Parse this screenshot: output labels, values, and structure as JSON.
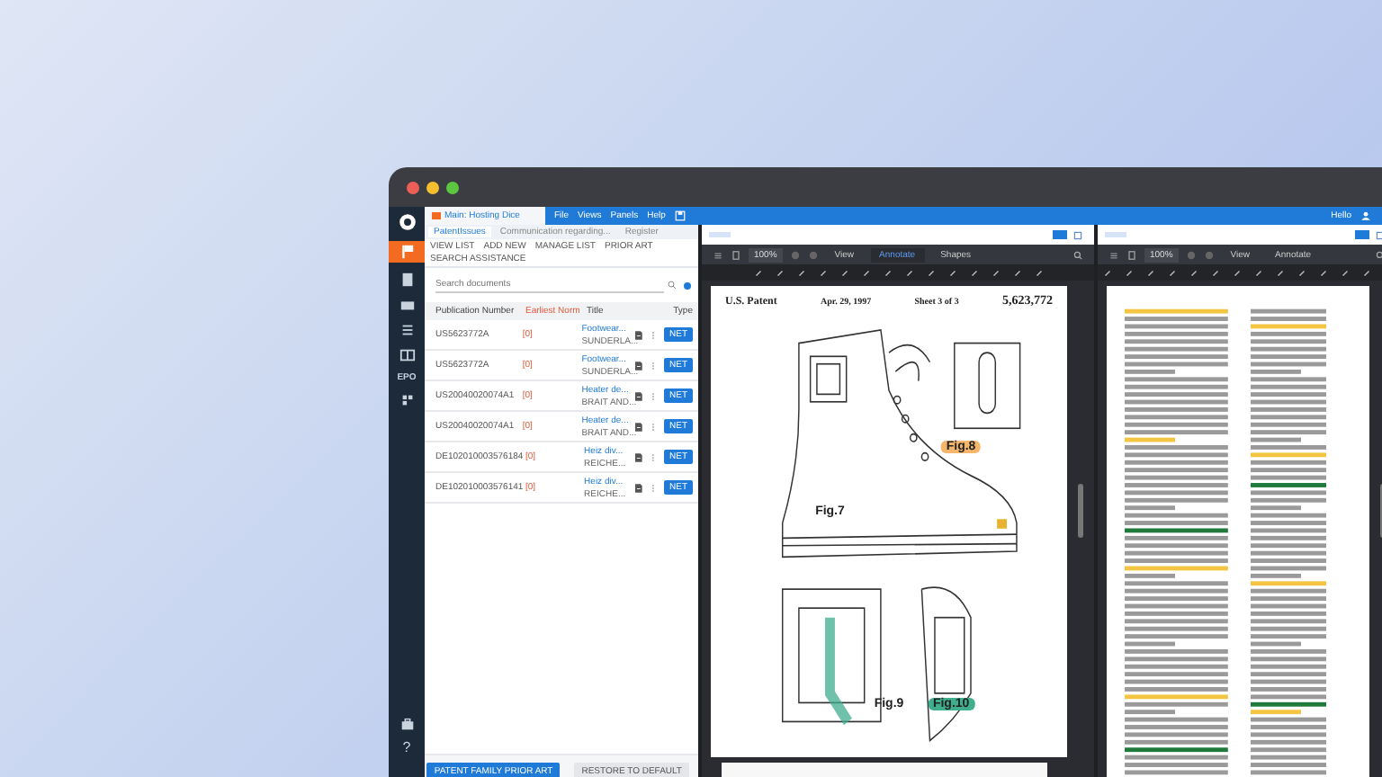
{
  "app_tab": {
    "title": "Main: Hosting Dice"
  },
  "menu": [
    "File",
    "Views",
    "Panels",
    "Help"
  ],
  "sidebar": {
    "label": "EPO",
    "help": "?"
  },
  "user": "Hello",
  "doc_tabs": [
    {
      "label": "PatentIssues",
      "selected": true
    },
    {
      "label": "Communication regarding...",
      "selected": false
    },
    {
      "label": "Register",
      "selected": false
    }
  ],
  "toolbar": [
    "VIEW LIST",
    "ADD NEW",
    "MANAGE LIST",
    "PRIOR ART",
    "SEARCH ASSISTANCE"
  ],
  "search": {
    "placeholder": "Search documents"
  },
  "table": {
    "columns": [
      "Publication Number",
      "Earliest Norm",
      "Title",
      "Type"
    ],
    "rows": [
      {
        "number": "US5623772A",
        "norm": "[0]",
        "title": "Footwear...",
        "subtitle": "SUNDERLA...",
        "type": "NET"
      },
      {
        "number": "US5623772A",
        "norm": "[0]",
        "title": "Footwear...",
        "subtitle": "SUNDERLA...",
        "type": "NET"
      },
      {
        "number": "US20040020074A1",
        "norm": "[0]",
        "title": "Heater de...",
        "subtitle": "BRAIT AND...",
        "type": "NET"
      },
      {
        "number": "US20040020074A1",
        "norm": "[0]",
        "title": "Heater de...",
        "subtitle": "BRAIT AND...",
        "type": "NET"
      },
      {
        "number": "DE102010003576184",
        "norm": "[0]",
        "title": "Heiz div...",
        "subtitle": "REICHE...",
        "type": "NET"
      },
      {
        "number": "DE102010003576141",
        "norm": "[0]",
        "title": "Heiz div...",
        "subtitle": "REICHE...",
        "type": "NET"
      }
    ]
  },
  "buttons": [
    {
      "label": "PATENT FAMILY PRIOR ART",
      "kind": "primary"
    },
    {
      "label": "RESTORE TO DEFAULT",
      "kind": "secondary"
    }
  ],
  "viewers": [
    {
      "zoom": "100%",
      "modes": [
        {
          "label": "View",
          "selected": false
        },
        {
          "label": "Annotate",
          "selected": true
        },
        {
          "label": "Shapes",
          "selected": false
        }
      ],
      "page": {
        "kind": "drawing",
        "header": [
          "U.S. Patent",
          "Apr. 29, 1997",
          "Sheet 3 of 3",
          "5,623,772"
        ],
        "figures": [
          {
            "label": "Fig.7"
          },
          {
            "label": "Fig.8",
            "color": "#f5b56a"
          },
          {
            "label": "Fig.9"
          },
          {
            "label": "Fig.10",
            "color": "#3fae8c"
          }
        ]
      }
    },
    {
      "zoom": "100%",
      "modes": [
        {
          "label": "View",
          "selected": false
        },
        {
          "label": "Annotate",
          "selected": false
        }
      ],
      "page": {
        "kind": "text"
      }
    }
  ]
}
